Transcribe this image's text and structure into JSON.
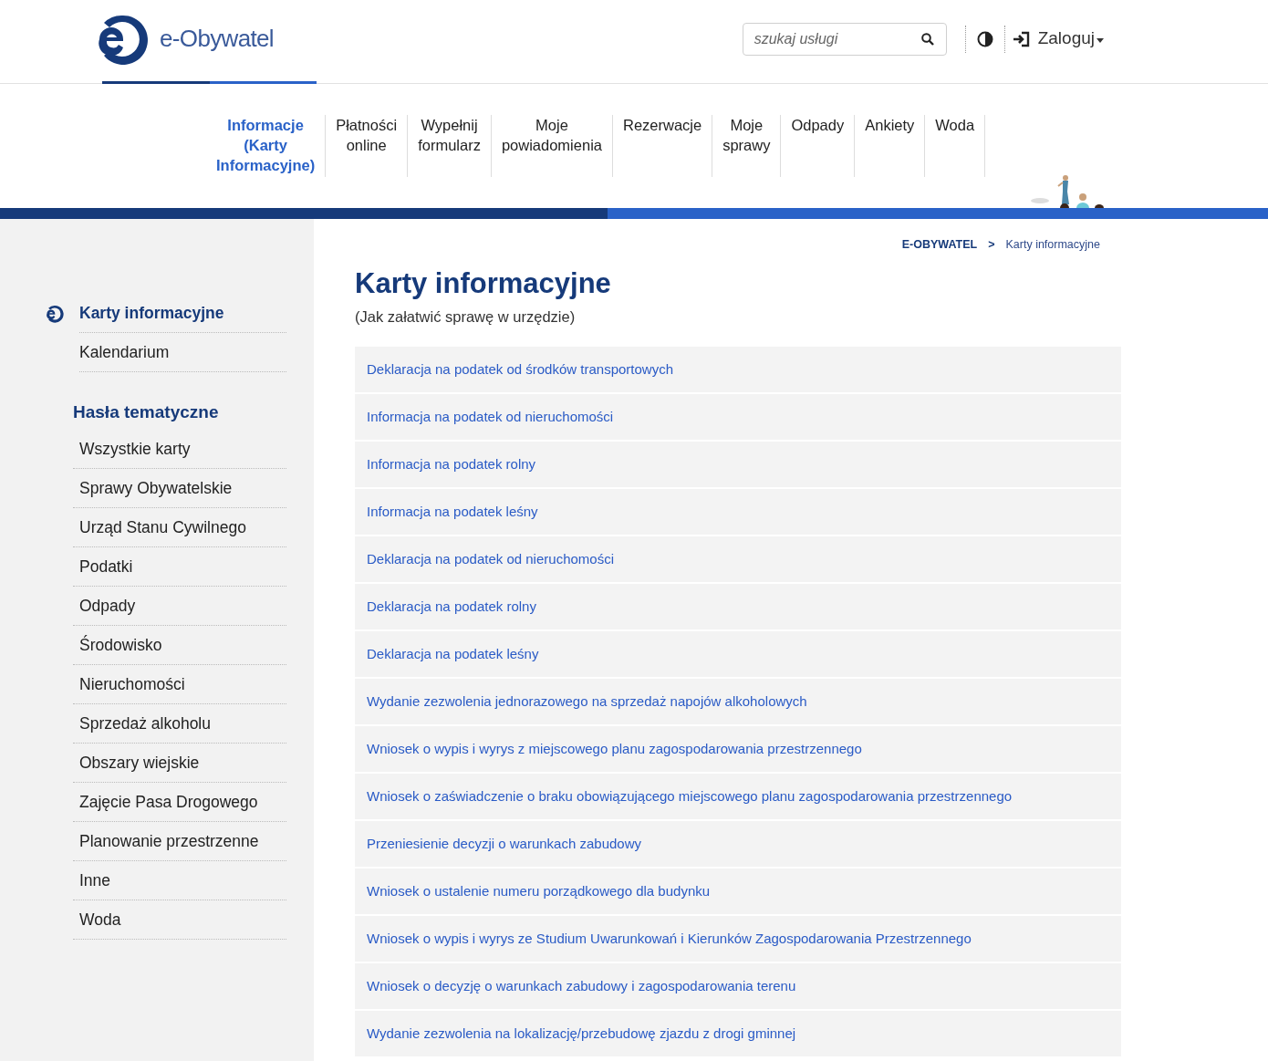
{
  "header": {
    "logo_text": "e-Obywatel",
    "search": {
      "placeholder": "szukaj usługi"
    },
    "login": "Zaloguj"
  },
  "nav": [
    {
      "label": "Informacje (Karty Informacyjne)",
      "selected": true
    },
    {
      "label": "Płatności online",
      "selected": false
    },
    {
      "label": "Wypełnij formularz",
      "selected": false
    },
    {
      "label": "Moje powiadomienia",
      "selected": false
    },
    {
      "label": "Rezerwacje",
      "selected": false
    },
    {
      "label": "Moje sprawy",
      "selected": false
    },
    {
      "label": "Odpady",
      "selected": false
    },
    {
      "label": "Ankiety",
      "selected": false
    },
    {
      "label": "Woda",
      "selected": false
    }
  ],
  "breadcrumb": [
    "E-OBYWATEL",
    ">",
    "Karty informacyjne"
  ],
  "sidebar": {
    "items": [
      {
        "label": "Karty informacyjne",
        "selected": true
      },
      {
        "label": "Kalendarium",
        "selected": false
      }
    ],
    "topics_heading": "Hasła tematyczne",
    "topics": [
      "Wszystkie karty",
      "Sprawy Obywatelskie",
      "Urząd Stanu Cywilnego",
      "Podatki",
      "Odpady",
      "Środowisko",
      "Nieruchomości",
      "Sprzedaż alkoholu",
      "Obszary wiejskie",
      "Zajęcie Pasa Drogowego",
      "Planowanie przestrzenne",
      "Inne",
      "Woda"
    ]
  },
  "page": {
    "title": "Karty informacyjne",
    "subtitle": "(Jak załatwić sprawę w urzędzie)",
    "cards": [
      "Deklaracja na podatek od środków transportowych",
      "Informacja na podatek od nieruchomości",
      "Informacja na podatek rolny",
      "Informacja na podatek leśny",
      "Deklaracja na podatek od nieruchomości",
      "Deklaracja na podatek rolny",
      "Deklaracja na podatek leśny",
      "Wydanie zezwolenia jednorazowego na sprzedaż napojów alkoholowych",
      "Wniosek o wypis i wyrys z miejscowego planu zagospodarowania przestrzennego",
      "Wniosek o zaświadczenie o braku obowiązującego miejscowego planu zagospodarowania przestrzennego",
      "Przeniesienie decyzji o warunkach zabudowy",
      "Wniosek o ustalenie numeru porządkowego dla budynku",
      "Wniosek o wypis i wyrys ze Studium Uwarunkowań i Kierunków Zagospodarowania Przestrzennego",
      "Wniosek o decyzję o warunkach zabudowy i zagospodarowania terenu",
      "Wydanie zezwolenia na lokalizację/przebudowę zjazdu z drogi gminnej"
    ]
  }
}
